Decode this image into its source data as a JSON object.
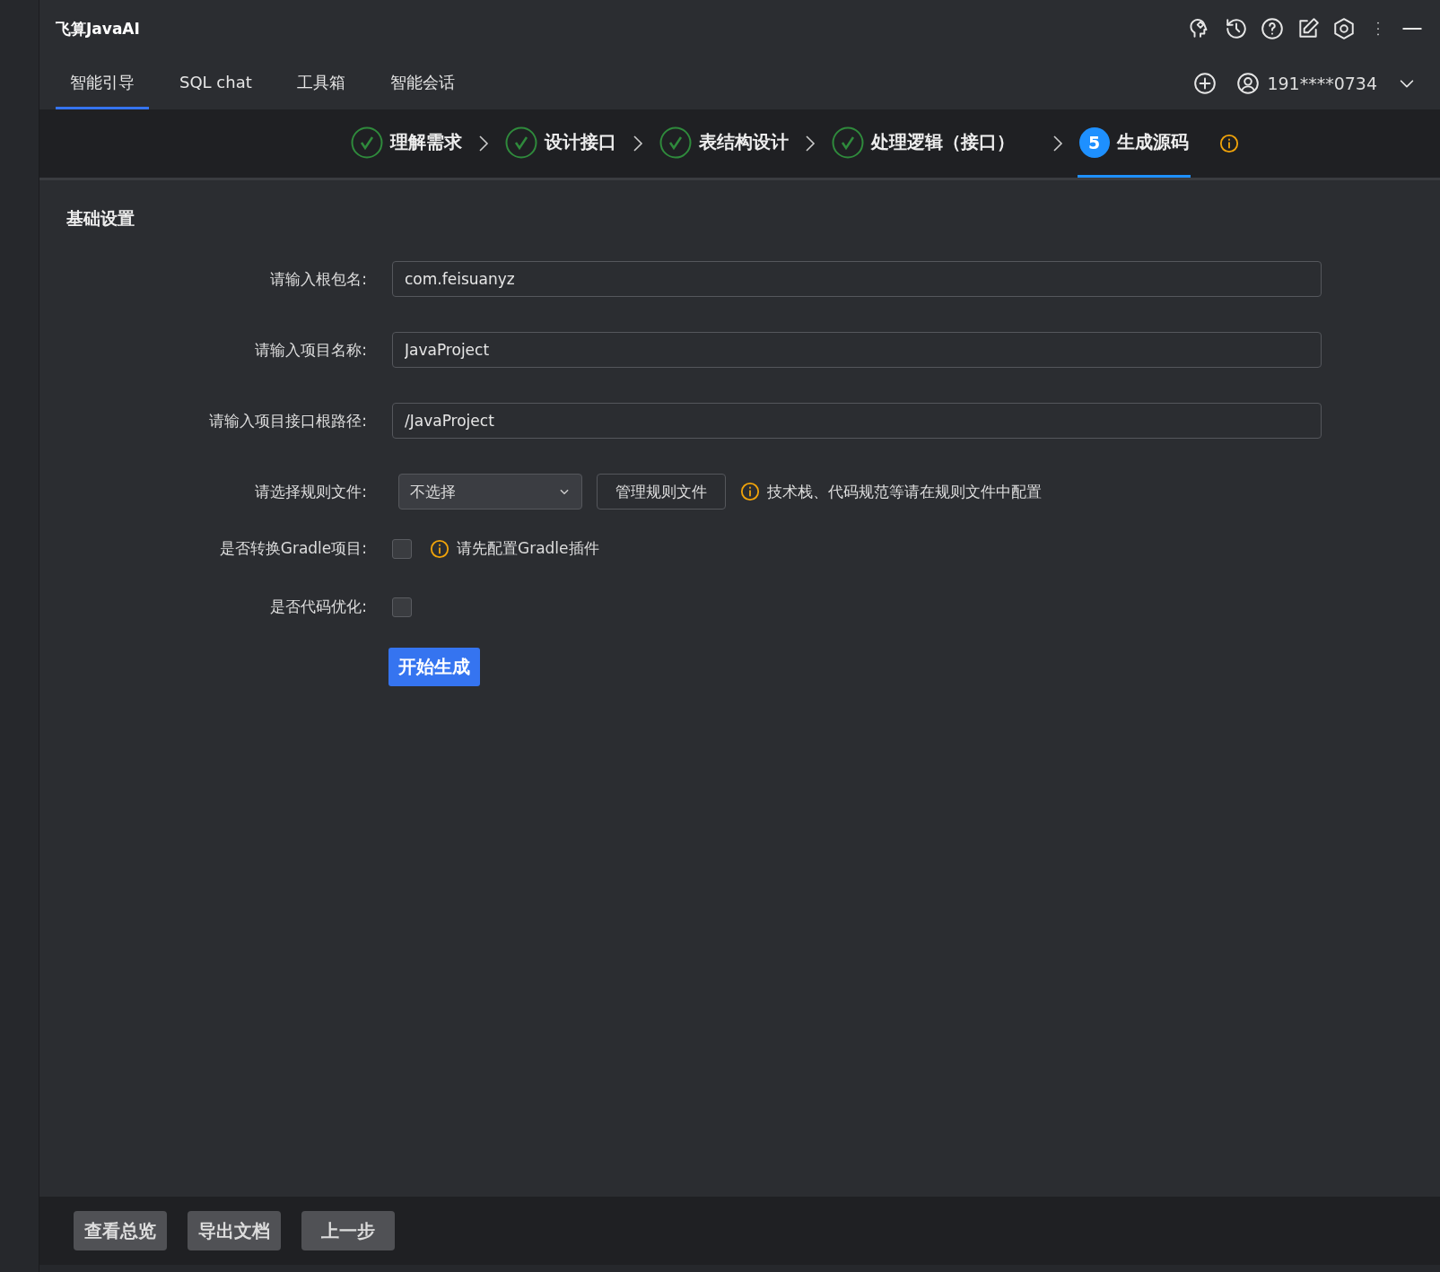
{
  "app": {
    "title": "飞算JavaAI"
  },
  "nav_tabs": [
    {
      "label": "智能引导",
      "selected": true
    },
    {
      "label": "SQL chat",
      "selected": false
    },
    {
      "label": "工具箱",
      "selected": false
    },
    {
      "label": "智能会话",
      "selected": false
    }
  ],
  "account": {
    "phone": "191****0734"
  },
  "steps": [
    {
      "label": "理解需求",
      "kind": "done"
    },
    {
      "label": "设计接口",
      "kind": "done"
    },
    {
      "label": "表结构设计",
      "kind": "done"
    },
    {
      "label": "处理逻辑（接口）",
      "kind": "done"
    },
    {
      "label": "生成源码",
      "kind": "current",
      "number": "5"
    }
  ],
  "section_title": "基础设置",
  "fields": [
    {
      "label": "请输入根包名:",
      "value": "com.feisuanyz"
    },
    {
      "label": "请输入项目名称:",
      "value": "JavaProject"
    },
    {
      "label": "请输入项目接口根路径:",
      "value": "/JavaProject"
    }
  ],
  "rule_file": {
    "label": "请选择规则文件:",
    "value": "不选择",
    "manage_button": "管理规则文件",
    "hint": "技术栈、代码规范等请在规则文件中配置"
  },
  "gradle": {
    "label": "是否转换Gradle项目:",
    "checked": false,
    "hint": "请先配置Gradle插件"
  },
  "optimize": {
    "label": "是否代码优化:",
    "checked": false
  },
  "submit": "开始生成",
  "footer_buttons": [
    "查看总览",
    "导出文档",
    "上一步"
  ]
}
